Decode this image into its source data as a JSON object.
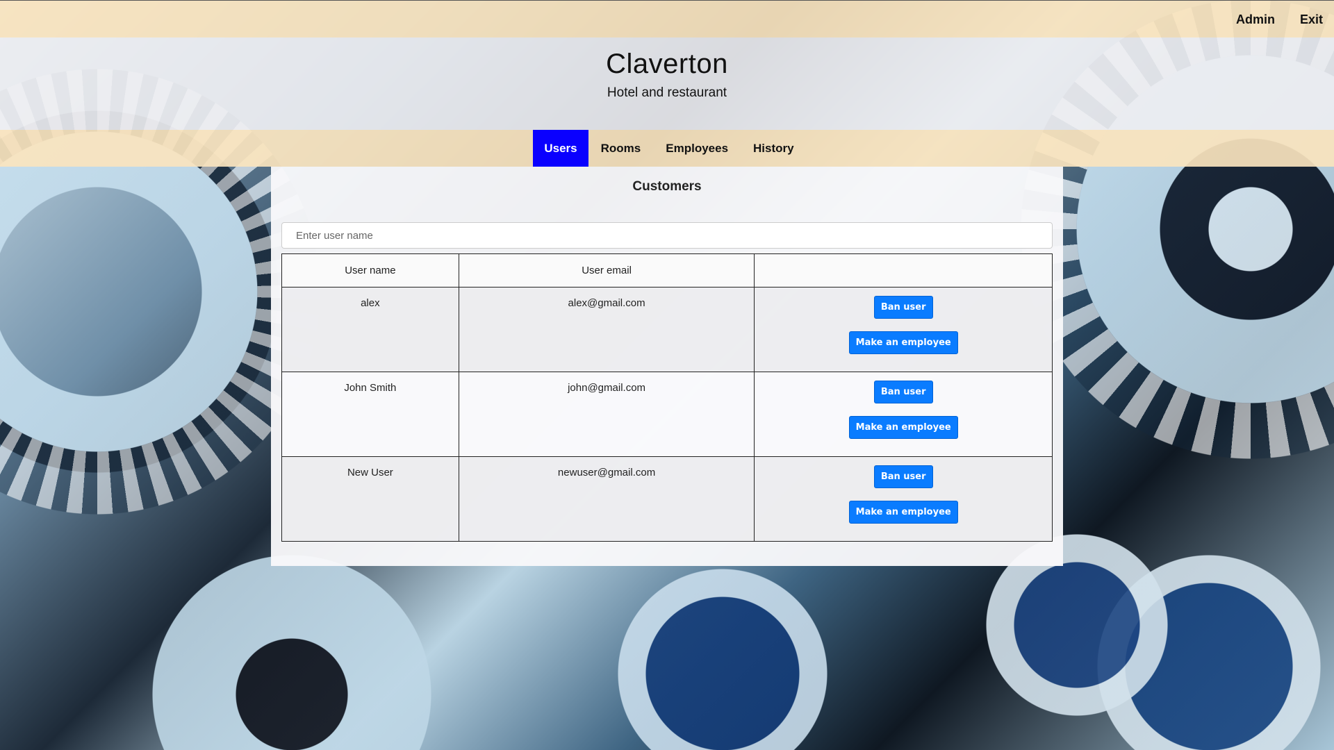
{
  "topbar": {
    "links": [
      "Admin",
      "Exit"
    ]
  },
  "header": {
    "title": "Claverton",
    "subtitle": "Hotel and restaurant"
  },
  "nav": {
    "tabs": [
      {
        "label": "Users",
        "active": true
      },
      {
        "label": "Rooms",
        "active": false
      },
      {
        "label": "Employees",
        "active": false
      },
      {
        "label": "History",
        "active": false
      }
    ]
  },
  "panel": {
    "heading": "Customers",
    "search_placeholder": "Enter user name",
    "search_value": "",
    "columns": [
      "User name",
      "User email",
      ""
    ],
    "rows": [
      {
        "name": "alex",
        "email": "alex@gmail.com",
        "ban_label": "Ban user",
        "employee_label": "Make an employee"
      },
      {
        "name": "John Smith",
        "email": "john@gmail.com",
        "ban_label": "Ban user",
        "employee_label": "Make an employee"
      },
      {
        "name": "New User",
        "email": "newuser@gmail.com",
        "ban_label": "Ban user",
        "employee_label": "Make an employee"
      }
    ]
  },
  "colors": {
    "bar_beige": "#fae4be",
    "active_tab": "#0a00ff",
    "button_blue": "#0a7cff"
  }
}
